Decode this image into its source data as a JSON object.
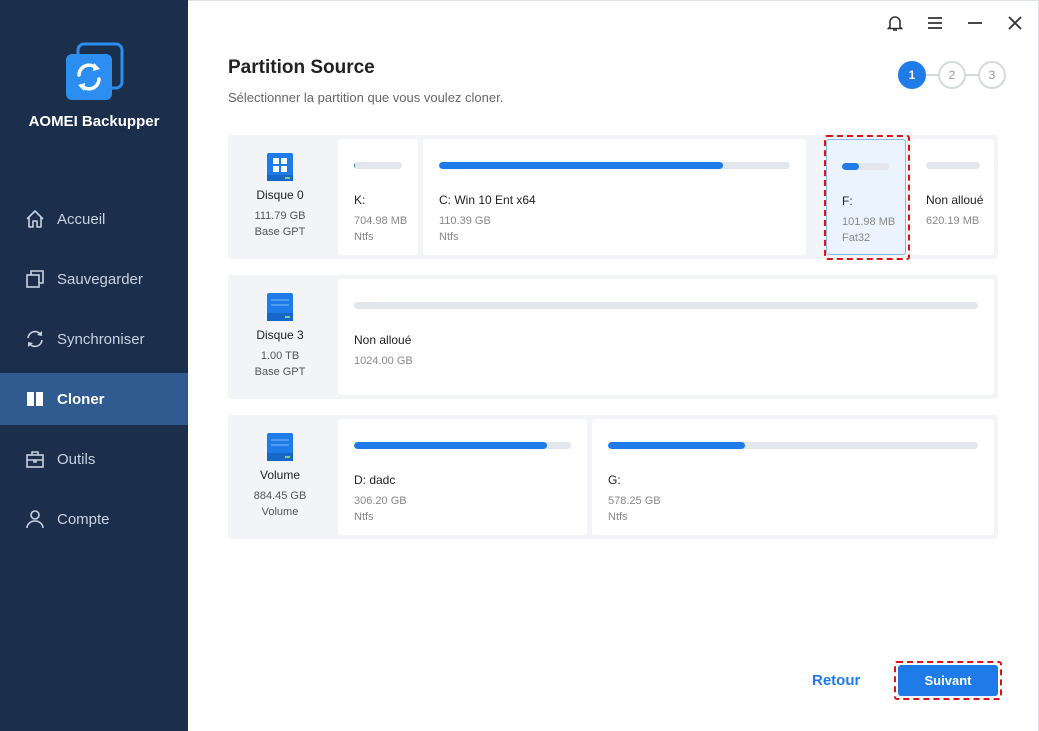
{
  "app": {
    "name": "AOMEI Backupper"
  },
  "nav": {
    "items": [
      {
        "label": "Accueil",
        "icon": "home-icon"
      },
      {
        "label": "Sauvegarder",
        "icon": "backup-icon"
      },
      {
        "label": "Synchroniser",
        "icon": "sync-icon"
      },
      {
        "label": "Cloner",
        "icon": "clone-icon",
        "active": true
      },
      {
        "label": "Outils",
        "icon": "toolbox-icon"
      },
      {
        "label": "Compte",
        "icon": "user-icon"
      }
    ]
  },
  "header": {
    "title": "Partition Source",
    "subtitle": "Sélectionner la partition que vous voulez cloner."
  },
  "steps": [
    "1",
    "2",
    "3"
  ],
  "disks": [
    {
      "name": "Disque 0",
      "size": "111.79 GB",
      "type": "Base GPT",
      "partitions": [
        {
          "name": "K:",
          "size": "704.98 MB",
          "fs": "Ntfs",
          "used": 0.02
        },
        {
          "name": "C: Win 10 Ent x64",
          "size": "110.39 GB",
          "fs": "Ntfs",
          "used": 0.81
        },
        {
          "name": "F:",
          "size": "101.98 MB",
          "fs": "Fat32",
          "used": 0.36,
          "selected": true
        },
        {
          "name": "Non alloué",
          "size": "620.19 MB",
          "fs": "",
          "used": 0
        }
      ]
    },
    {
      "name": "Disque 3",
      "size": "1.00 TB",
      "type": "Base GPT",
      "partitions": [
        {
          "name": "Non alloué",
          "size": "1024.00 GB",
          "fs": "",
          "used": 0
        }
      ]
    },
    {
      "name": "Volume",
      "size": "884.45 GB",
      "type": "Volume",
      "partitions": [
        {
          "name": "D: dadc",
          "size": "306.20 GB",
          "fs": "Ntfs",
          "used": 0.89
        },
        {
          "name": "G:",
          "size": "578.25 GB",
          "fs": "Ntfs",
          "used": 0.37
        }
      ]
    }
  ],
  "buttons": {
    "back": "Retour",
    "next": "Suivant"
  },
  "colors": {
    "accent": "#1e7be8",
    "sidebar": "#1b2e4b",
    "highlight": "#d7141a"
  }
}
